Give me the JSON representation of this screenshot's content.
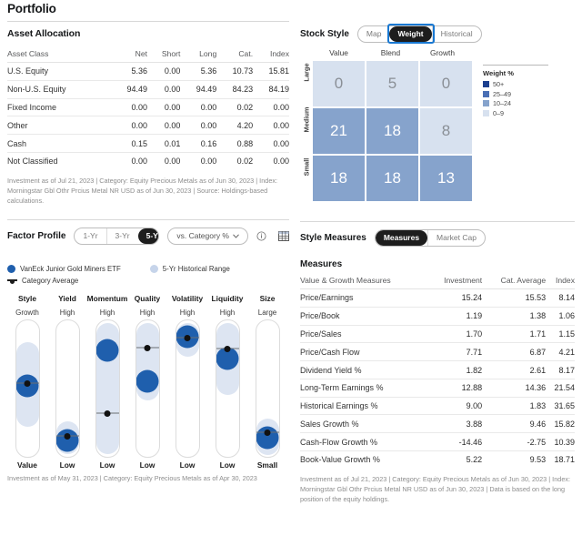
{
  "page": {
    "title": "Portfolio"
  },
  "asset_allocation": {
    "heading": "Asset Allocation",
    "columns": [
      "Asset Class",
      "Net",
      "Short",
      "Long",
      "Cat.",
      "Index"
    ],
    "rows": [
      {
        "label": "U.S. Equity",
        "net": "5.36",
        "short": "0.00",
        "long": "5.36",
        "cat": "10.73",
        "index": "15.81"
      },
      {
        "label": "Non-U.S. Equity",
        "net": "94.49",
        "short": "0.00",
        "long": "94.49",
        "cat": "84.23",
        "index": "84.19"
      },
      {
        "label": "Fixed Income",
        "net": "0.00",
        "short": "0.00",
        "long": "0.00",
        "cat": "0.02",
        "index": "0.00"
      },
      {
        "label": "Other",
        "net": "0.00",
        "short": "0.00",
        "long": "0.00",
        "cat": "4.20",
        "index": "0.00"
      },
      {
        "label": "Cash",
        "net": "0.15",
        "short": "0.01",
        "long": "0.16",
        "cat": "0.88",
        "index": "0.00"
      },
      {
        "label": "Not Classified",
        "net": "0.00",
        "short": "0.00",
        "long": "0.00",
        "cat": "0.02",
        "index": "0.00"
      }
    ],
    "footnote": "Investment as of Jul 21, 2023 | Category: Equity Precious Metals as of Jun 30, 2023 | Index: Morningstar Gbl Othr Prcius Metal NR USD as of Jun 30, 2023 | Source: Holdings-based calculations."
  },
  "stock_style": {
    "heading": "Stock Style",
    "tabs": [
      {
        "label": "Map",
        "selected": false
      },
      {
        "label": "Weight",
        "selected": true
      },
      {
        "label": "Historical",
        "selected": false
      }
    ],
    "col_labels": [
      "Value",
      "Blend",
      "Growth"
    ],
    "row_labels": [
      "Large",
      "Medium",
      "Small"
    ],
    "cells": [
      [
        {
          "value": "0",
          "fill": "#d7e1ef",
          "text": "#8a8f96"
        },
        {
          "value": "5",
          "fill": "#d7e1ef",
          "text": "#8a8f96"
        },
        {
          "value": "0",
          "fill": "#d7e1ef",
          "text": "#8a8f96"
        }
      ],
      [
        {
          "value": "21",
          "fill": "#86a3cc",
          "text": "#ffffff"
        },
        {
          "value": "18",
          "fill": "#86a3cc",
          "text": "#ffffff"
        },
        {
          "value": "8",
          "fill": "#d7e1ef",
          "text": "#8a8f96"
        }
      ],
      [
        {
          "value": "18",
          "fill": "#86a3cc",
          "text": "#ffffff"
        },
        {
          "value": "18",
          "fill": "#86a3cc",
          "text": "#ffffff"
        },
        {
          "value": "13",
          "fill": "#86a3cc",
          "text": "#ffffff"
        }
      ]
    ],
    "legend": {
      "title": "Weight %",
      "items": [
        {
          "label": "50+",
          "color": "#1b3f8f"
        },
        {
          "label": "25–49",
          "color": "#4a6fb5"
        },
        {
          "label": "10–24",
          "color": "#86a3cc"
        },
        {
          "label": "0–9",
          "color": "#d7e1ef"
        }
      ]
    }
  },
  "factor_profile": {
    "heading": "Factor Profile",
    "period_tabs": [
      {
        "label": "1-Yr",
        "selected": false
      },
      {
        "label": "3-Yr",
        "selected": false
      },
      {
        "label": "5-Yr",
        "selected": true
      }
    ],
    "compare_dropdown": "vs. Category % ",
    "legend": [
      {
        "label": "VanEck Junior Gold Miners ETF",
        "marker": "dot",
        "color": "#1f5fad"
      },
      {
        "label": "5-Yr Historical Range",
        "marker": "dot",
        "color": "#c6d4ea"
      },
      {
        "label": "Category Average",
        "marker": "dash",
        "color": "#1d1d1d"
      }
    ],
    "factors": [
      {
        "name": "Style",
        "top": "Growth",
        "bottom": "Value",
        "band_top_pct": 16,
        "band_height_pct": 62,
        "fund_pct": 48,
        "avg_pct": 46
      },
      {
        "name": "Yield",
        "top": "High",
        "bottom": "Low",
        "band_top_pct": 74,
        "band_height_pct": 24,
        "fund_pct": 88,
        "avg_pct": 85
      },
      {
        "name": "Momentum",
        "top": "High",
        "bottom": "Low",
        "band_top_pct": 2,
        "band_height_pct": 96,
        "fund_pct": 22,
        "avg_pct": 68
      },
      {
        "name": "Quality",
        "top": "High",
        "bottom": "Low",
        "band_top_pct": 2,
        "band_height_pct": 57,
        "fund_pct": 45,
        "avg_pct": 20
      },
      {
        "name": "Volatility",
        "top": "High",
        "bottom": "Low",
        "band_top_pct": 2,
        "band_height_pct": 25,
        "fund_pct": 12,
        "avg_pct": 13
      },
      {
        "name": "Liquidity",
        "top": "High",
        "bottom": "Low",
        "band_top_pct": 2,
        "band_height_pct": 53,
        "fund_pct": 28,
        "avg_pct": 21
      },
      {
        "name": "Size",
        "top": "Large",
        "bottom": "Small",
        "band_top_pct": 72,
        "band_height_pct": 27,
        "fund_pct": 86,
        "avg_pct": 82
      }
    ],
    "footnote": "Investment as of May 31, 2023 | Category: Equity Precious Metals as of Apr 30, 2023"
  },
  "style_measures": {
    "heading": "Style Measures",
    "tabs": [
      {
        "label": "Measures",
        "selected": true
      },
      {
        "label": "Market Cap",
        "selected": false
      }
    ],
    "sub_heading": "Measures",
    "columns": [
      "Value & Growth Measures",
      "Investment",
      "Cat. Average",
      "Index"
    ],
    "rows": [
      {
        "label": "Price/Earnings",
        "investment": "15.24",
        "cat": "15.53",
        "index": "8.14"
      },
      {
        "label": "Price/Book",
        "investment": "1.19",
        "cat": "1.38",
        "index": "1.06"
      },
      {
        "label": "Price/Sales",
        "investment": "1.70",
        "cat": "1.71",
        "index": "1.15"
      },
      {
        "label": "Price/Cash Flow",
        "investment": "7.71",
        "cat": "6.87",
        "index": "4.21"
      },
      {
        "label": "Dividend Yield %",
        "investment": "1.82",
        "cat": "2.61",
        "index": "8.17"
      },
      {
        "label": "Long-Term Earnings %",
        "investment": "12.88",
        "cat": "14.36",
        "index": "21.54"
      },
      {
        "label": "Historical Earnings %",
        "investment": "9.00",
        "cat": "1.83",
        "index": "31.65"
      },
      {
        "label": "Sales Growth %",
        "investment": "3.88",
        "cat": "9.46",
        "index": "15.82"
      },
      {
        "label": "Cash-Flow Growth %",
        "investment": "-14.46",
        "cat": "-2.75",
        "index": "10.39"
      },
      {
        "label": "Book-Value Growth %",
        "investment": "5.22",
        "cat": "9.53",
        "index": "18.71"
      }
    ],
    "footnote": "Investment as of Jul 21, 2023 | Category: Equity Precious Metals as of Jun 30, 2023 | Index: Morningstar Gbl Othr Prcius Metal NR USD as of Jun 30, 2023 | Data is based on the long position of the equity holdings."
  }
}
